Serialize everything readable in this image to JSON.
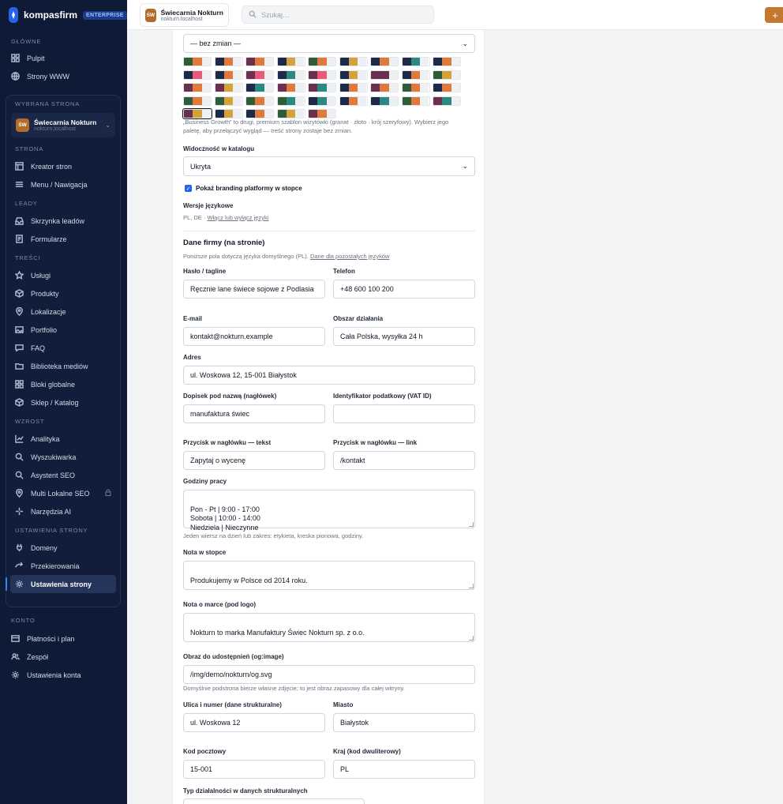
{
  "brand": {
    "name": "kompasfirm",
    "badge": "ENTERPRISE"
  },
  "sidebar": {
    "glowne_title": "GŁÓWNE",
    "glowne": [
      {
        "label": "Pulpit",
        "icon": "grid-icon"
      },
      {
        "label": "Strony WWW",
        "icon": "globe-icon"
      }
    ],
    "selected_site_title": "WYBRANA STRONA",
    "site": {
      "initials": "ŚW",
      "name": "Świecarnia Nokturn",
      "domain": "nokturn.localhost"
    },
    "strona_title": "STRONA",
    "strona": [
      {
        "label": "Kreator stron"
      },
      {
        "label": "Menu / Nawigacja"
      }
    ],
    "leady_title": "LEADY",
    "leady": [
      {
        "label": "Skrzynka leadów"
      },
      {
        "label": "Formularze"
      }
    ],
    "tresci_title": "TREŚCI",
    "tresci": [
      {
        "label": "Usługi"
      },
      {
        "label": "Produkty"
      },
      {
        "label": "Lokalizacje"
      },
      {
        "label": "Portfolio"
      },
      {
        "label": "FAQ"
      },
      {
        "label": "Biblioteka mediów"
      },
      {
        "label": "Bloki globalne"
      },
      {
        "label": "Sklep / Katalog"
      }
    ],
    "wzrost_title": "WZROST",
    "wzrost": [
      {
        "label": "Analityka"
      },
      {
        "label": "Wyszukiwarka"
      },
      {
        "label": "Asystent SEO"
      },
      {
        "label": "Multi Lokalne SEO"
      },
      {
        "label": "Narzędzia AI"
      }
    ],
    "ustawienia_title": "USTAWIENIA STRONY",
    "ustawienia": [
      {
        "label": "Domeny"
      },
      {
        "label": "Przekierowania"
      },
      {
        "label": "Ustawienia strony"
      }
    ],
    "konto_title": "KONTO",
    "konto": [
      {
        "label": "Płatności i plan"
      },
      {
        "label": "Zespół"
      },
      {
        "label": "Ustawienia konta"
      }
    ]
  },
  "topbar": {
    "site_initials": "ŚW",
    "site_name": "Świecarnia Nokturn",
    "site_domain": "nokturn.localhost",
    "search_placeholder": "Szukaj…",
    "plus": "+"
  },
  "form": {
    "palette_select": "— bez zmian —",
    "palette_colors": {
      "navy": "#1e2a4a",
      "gold": "#d4a13a",
      "green": "#2f5d3a",
      "orange": "#e07a3c",
      "teal": "#2a8a82",
      "plum": "#6a3050",
      "pink": "#e85a7a",
      "light": "#eef1f3"
    },
    "palette_hint": "„Business Growth” to drugi, premium szablon wizytówki (granat · złoto · krój szeryfowy). Wybierz jego paletę, aby przełączyć wygląd — treść strony zostaje bez zmian.",
    "visibility_label": "Widoczność w katalogu",
    "visibility_value": "Ukryta",
    "branding_label": "Pokaż branding platformy w stopce",
    "lang_label": "Wersje językowe",
    "lang_value": "PL, DE ·",
    "lang_link": "Włącz lub wyłącz języki",
    "company_title": "Dane firmy (na stronie)",
    "company_hint": "Poniższe pola dotyczą języka domyślnego (PL).",
    "company_hint_link": "Dane dla pozostałych języków",
    "tagline_label": "Hasło / tagline",
    "tagline_value": "Ręcznie lane świece sojowe z Podlasia",
    "phone_label": "Telefon",
    "phone_value": "+48 600 100 200",
    "email_label": "E-mail",
    "email_value": "kontakt@nokturn.example",
    "area_label": "Obszar działania",
    "area_value": "Cała Polska, wysyłka 24 h",
    "address_label": "Adres",
    "address_value": "ul. Woskowa 12, 15-001 Białystok",
    "subtitle_label": "Dopisek pod nazwą (nagłówek)",
    "subtitle_value": "manufaktura świec",
    "vat_label": "Identyfikator podatkowy (VAT ID)",
    "vat_value": "",
    "cta_text_label": "Przycisk w nagłówku — tekst",
    "cta_text_value": "Zapytaj o wycenę",
    "cta_link_label": "Przycisk w nagłówku — link",
    "cta_link_value": "/kontakt",
    "hours_label": "Godziny pracy",
    "hours_value": "Pon - Pt | 9:00 - 17:00\nSobota | 10:00 - 14:00\nNiedziela | Nieczynne",
    "hours_hint": "Jeden wiersz na dzień lub zakres: etykieta, kreska pionowa, godziny.",
    "footer_note_label": "Nota w stopce",
    "footer_note_value": "Produkujemy w Polsce od 2014 roku.",
    "brand_note_label": "Nota o marce (pod logo)",
    "brand_note_value": "Nokturn to marka Manufaktury Świec Nokturn sp. z o.o.",
    "og_label": "Obraz do udostępnień (og:image)",
    "og_value": "/img/demo/nokturn/og.svg",
    "og_hint": "Domyślnie podstrona bierze własne zdjęcie; to jest obraz zapasowy dla całej witryny.",
    "street_label": "Ulica i numer (dane strukturalne)",
    "street_value": "ul. Woskowa 12",
    "city_label": "Miasto",
    "city_value": "Białystok",
    "postal_label": "Kod pocztowy",
    "postal_value": "15-001",
    "country_label": "Kraj (kod dwuliterowy)",
    "country_value": "PL",
    "business_type_label": "Typ działalności w danych strukturalnych"
  }
}
